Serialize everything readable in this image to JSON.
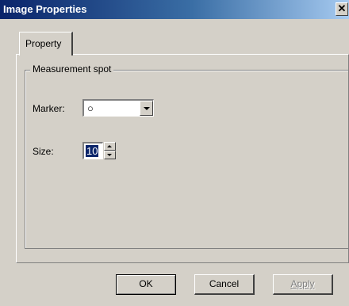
{
  "window": {
    "title": "Image Properties",
    "close_glyph": "✕",
    "close_icon": "close-icon"
  },
  "tabs": [
    {
      "label": "Property",
      "selected": true
    }
  ],
  "group": {
    "label": "Measurement spot"
  },
  "marker": {
    "label": "Marker:",
    "value": "○",
    "dropdown_icon": "chevron-down-icon"
  },
  "size": {
    "label": "Size:",
    "value": "10",
    "up_icon": "spin-up-icon",
    "down_icon": "spin-down-icon"
  },
  "buttons": {
    "ok": "OK",
    "cancel": "Cancel",
    "apply": "Apply",
    "apply_enabled": false
  },
  "colors": {
    "titlebar_start": "#0a246a",
    "titlebar_end": "#a6caf0",
    "face": "#d4d0c8",
    "selection": "#0a246a"
  }
}
